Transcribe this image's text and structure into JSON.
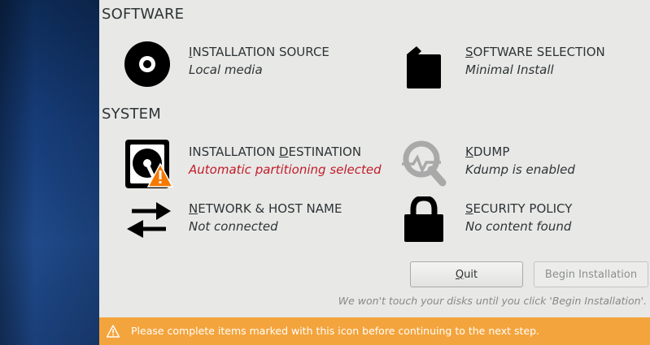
{
  "sections": {
    "software": "SOFTWARE",
    "system": "SYSTEM"
  },
  "spokes": {
    "installation_source": {
      "mnemonic": "I",
      "rest": "NSTALLATION SOURCE",
      "status": "Local media",
      "icon": "disc-icon"
    },
    "software_selection": {
      "mnemonic": "S",
      "rest": "OFTWARE SELECTION",
      "status": "Minimal Install",
      "icon": "package-icon"
    },
    "installation_destination": {
      "pre": "INSTALLATION ",
      "mnemonic": "D",
      "rest": "ESTINATION",
      "status": "Automatic partitioning selected",
      "icon": "hard-disk-icon"
    },
    "kdump": {
      "mnemonic": "K",
      "rest": "DUMP",
      "status": "Kdump is enabled",
      "icon": "magnifier-icon"
    },
    "network": {
      "mnemonic": "N",
      "rest": "ETWORK & HOST NAME",
      "status": "Not connected",
      "icon": "network-arrows-icon"
    },
    "security_policy": {
      "mnemonic": "S",
      "rest": "ECURITY POLICY",
      "status": "No content found",
      "icon": "lock-icon"
    }
  },
  "buttons": {
    "quit_mnemonic": "Q",
    "quit_rest": "uit",
    "begin": "Begin Installation"
  },
  "hint": "We won't touch your disks until you click 'Begin Installation'.",
  "warning_bar": {
    "text": "Please complete items marked with this icon before continuing to the next step.",
    "color": "#f4a43c"
  },
  "colors": {
    "warning_text": "#c01c28",
    "sidebar": "#163c78"
  }
}
